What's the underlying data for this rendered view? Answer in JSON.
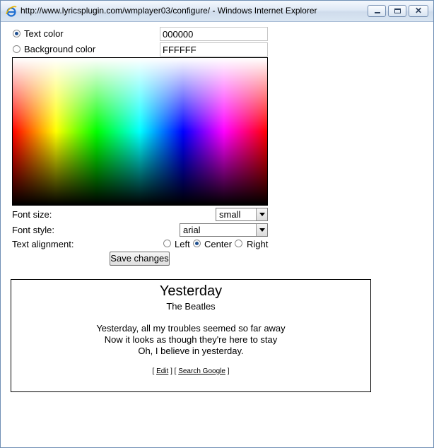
{
  "window": {
    "title": "http://www.lyricsplugin.com/wmplayer03/configure/ - Windows Internet Explorer",
    "close_glyph": "✕"
  },
  "colors": {
    "text_color_label": "Text color",
    "text_color_value": "000000",
    "background_color_label": "Background color",
    "background_color_value": "FFFFFF"
  },
  "font": {
    "size_label": "Font size:",
    "size_value": "small",
    "style_label": "Font style:",
    "style_value": "arial"
  },
  "alignment": {
    "label": "Text alignment:",
    "left": "Left",
    "center": "Center",
    "right": "Right",
    "selected": "center"
  },
  "save_label": "Save changes",
  "preview": {
    "title": "Yesterday",
    "artist": "The Beatles",
    "lines": [
      "Yesterday, all my troubles seemed so far away",
      "Now it looks as though they're here to stay",
      "Oh, I believe in yesterday."
    ],
    "bracket_open": "[",
    "bracket_close": "]",
    "edit_link": "Edit",
    "search_link": "Search Google"
  },
  "icons": {
    "browser": "ie-icon",
    "minimize": "minimize-icon",
    "maximize": "maximize-icon",
    "close": "close-icon"
  },
  "theme": {
    "titlebar": "#dfe9f5",
    "border": "#6f8fb4",
    "radio_selected": "#1f4f8f"
  }
}
